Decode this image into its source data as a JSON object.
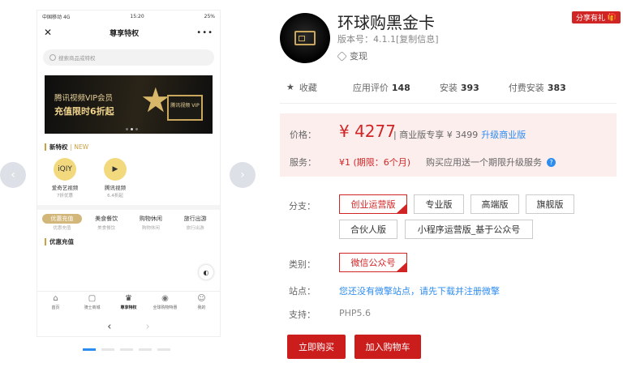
{
  "phone": {
    "status": {
      "carrier": "中国移动",
      "network": "4G",
      "time": "15:20",
      "battery": "25%"
    },
    "nav": {
      "close_icon": "close-icon",
      "title": "尊享特权",
      "more": "•••"
    },
    "search_placeholder": "搜索商品或特权",
    "banner": {
      "line1": "腾讯视频VIP会员",
      "line2": "充值限时6折起",
      "tv_label": "腾讯视频 VIP"
    },
    "section_new": {
      "title": "新特权",
      "tag": "| NEW"
    },
    "apps": [
      {
        "icon": "iqiyi",
        "name": "爱奇艺视频",
        "sub": "7折优惠"
      },
      {
        "icon": "▶",
        "name": "腾讯视频",
        "sub": "6.4折起"
      }
    ],
    "categories": [
      {
        "label": "优惠充值",
        "sub": "优惠充值"
      },
      {
        "label": "美食餐饮",
        "sub": "美食餐饮"
      },
      {
        "label": "购物休闲",
        "sub": "购物休闲"
      },
      {
        "label": "旅行出游",
        "sub": "旅行出游"
      }
    ],
    "section_recharge": "优惠充值",
    "tabs": [
      {
        "icon": "⌂",
        "label": "首页"
      },
      {
        "icon": "▢",
        "label": "骑士商城"
      },
      {
        "icon": "♛",
        "label": "尊享特权"
      },
      {
        "icon": "◉",
        "label": "全球购物特惠"
      },
      {
        "icon": "☺",
        "label": "我的"
      }
    ],
    "pager": {
      "prev": "‹",
      "next": "›"
    }
  },
  "carousel": {
    "prev": "‹",
    "next": "›"
  },
  "product": {
    "title": "环球购黑金卡",
    "version": "版本号：4.1.1[复制信息]",
    "monetize": "变现",
    "share": "分享有礼",
    "stats": {
      "favorite": "收藏",
      "rating_label": "应用评价",
      "rating": "148",
      "install_label": "安装",
      "install": "393",
      "paid_label": "付费安装",
      "paid": "383"
    },
    "price": {
      "label": "价格：",
      "value": "¥ 4277",
      "biz": "| 商业版专享 ¥ 3499",
      "upgrade": "升级商业版"
    },
    "service": {
      "label": "服务：",
      "value": "¥1 (期限：6个月)",
      "note": "购买应用送一个期限升级服务"
    },
    "branch_label": "分支：",
    "branches": [
      "创业运营版",
      "专业版",
      "高端版",
      "旗舰版",
      "合伙人版",
      "小程序运营版_基于公众号"
    ],
    "type_label": "类别：",
    "type_value": "微信公众号",
    "site_label": "站点：",
    "site_text": "您还没有微擎站点，请先下载并注册微擎",
    "support_label": "支持：",
    "support_text": "PHP5.6",
    "buy_now": "立即购买",
    "add_cart": "加入购物车"
  },
  "colors": {
    "accent": "#d12525",
    "link": "#2d8cf0",
    "gold": "#c9a044"
  }
}
